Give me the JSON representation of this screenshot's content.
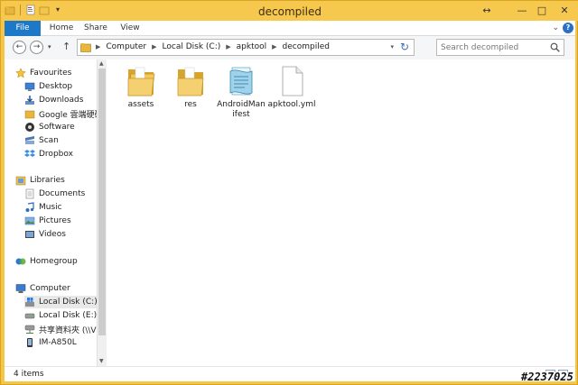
{
  "window": {
    "title": "decompiled",
    "min_glyph": "—",
    "max_glyph": "□",
    "close_glyph": "✕",
    "resize_glyph": "↔"
  },
  "ribbon": {
    "tabs": [
      {
        "label": "File"
      },
      {
        "label": "Home"
      },
      {
        "label": "Share"
      },
      {
        "label": "View"
      }
    ],
    "expand_glyph": "⌄",
    "help_glyph": "?"
  },
  "nav": {
    "breadcrumb": [
      "Computer",
      "Local Disk (C:)",
      "apktool",
      "decompiled"
    ],
    "search_placeholder": "Search decompiled"
  },
  "sidebar": {
    "favourites": {
      "header": "Favourites",
      "items": [
        "Desktop",
        "Downloads",
        "Google 雲端硬碟",
        "Software",
        "Scan",
        "Dropbox"
      ]
    },
    "libraries": {
      "header": "Libraries",
      "items": [
        "Documents",
        "Music",
        "Pictures",
        "Videos"
      ]
    },
    "homegroup": "Homegroup",
    "computer": {
      "header": "Computer",
      "items": [
        "Local Disk (C:)",
        "Local Disk (E:)",
        "共享資料夾 (\\\\V",
        "IM-A850L"
      ]
    }
  },
  "files": [
    {
      "name": "assets",
      "type": "folder"
    },
    {
      "name": "res",
      "type": "folder"
    },
    {
      "name": "AndroidManifest",
      "type": "manifest"
    },
    {
      "name": "apktool.yml",
      "type": "file"
    }
  ],
  "status": {
    "count": "4 items"
  },
  "watermark": "#2237025",
  "colors": {
    "accent": "#1e78c8",
    "frame": "#f6c446"
  }
}
